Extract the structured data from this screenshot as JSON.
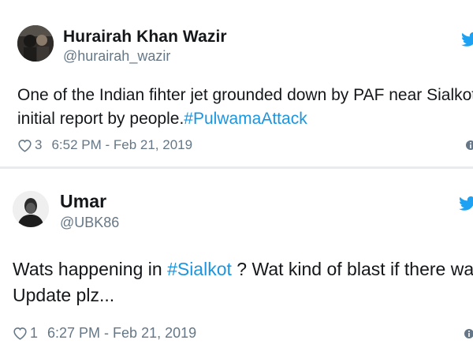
{
  "tweets": [
    {
      "display_name": "Hurairah Khan Wazir",
      "handle": "@hurairah_wazir",
      "text_line1": "One of the Indian fihter jet grounded down by PAF near Sialkot",
      "text_line2_prefix": "initial report by people.",
      "text_line2_hashtag": "#PulwamaAttack",
      "likes": "3",
      "timestamp": "6:52 PM - Feb 21, 2019",
      "icons": [
        "avatar",
        "twitter-bird-icon",
        "heart-icon",
        "info-icon"
      ]
    },
    {
      "display_name": "Umar",
      "handle": "@UBK86",
      "text_line1_prefix": "Wats happening in ",
      "text_line1_hashtag": "#Sialkot",
      "text_line1_suffix": " ? Wat kind of blast if there was any?",
      "text_line2": "Update plz...",
      "likes": "1",
      "timestamp": "6:27 PM - Feb 21, 2019",
      "icons": [
        "avatar",
        "twitter-bird-icon",
        "heart-icon",
        "info-icon"
      ]
    }
  ],
  "colors": {
    "twitter_blue": "#1da1f2",
    "hashtag": "#1b95e0",
    "secondary_text": "#657786",
    "divider": "#e6ecf0"
  }
}
